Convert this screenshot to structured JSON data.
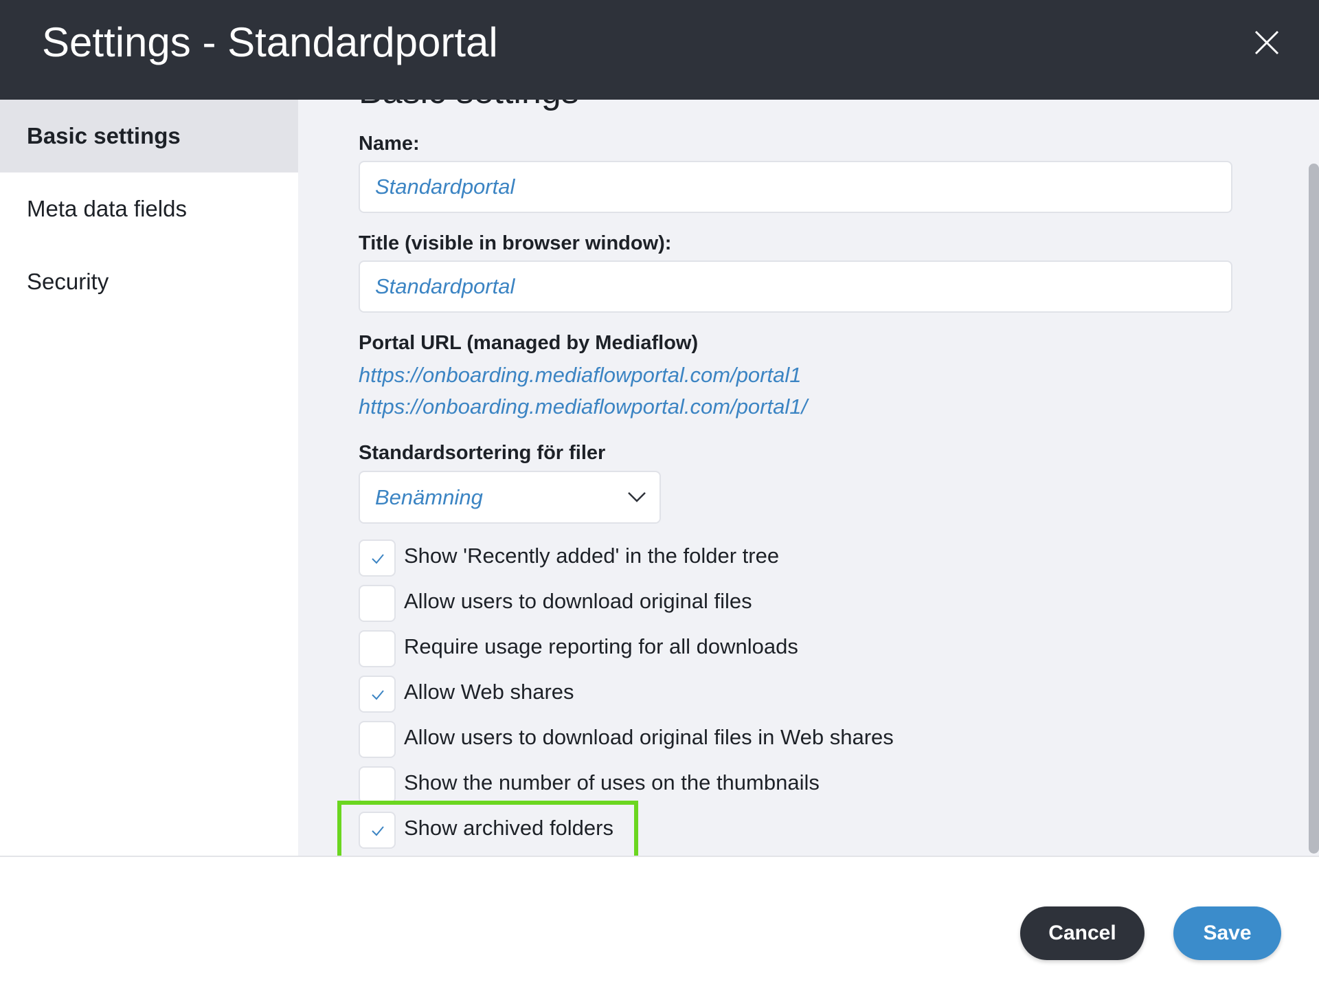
{
  "header": {
    "title": "Settings - Standardportal"
  },
  "sidebar": {
    "items": [
      {
        "label": "Basic settings",
        "active": true
      },
      {
        "label": "Meta data fields",
        "active": false
      },
      {
        "label": "Security",
        "active": false
      }
    ]
  },
  "main": {
    "section_title": "Basic settings",
    "name_label": "Name:",
    "name_value": "Standardportal",
    "title_label": "Title (visible in browser window):",
    "title_value": "Standardportal",
    "portal_url_label": "Portal URL (managed by Mediaflow)",
    "portal_urls": [
      "https://onboarding.mediaflowportal.com/portal1",
      "https://onboarding.mediaflowportal.com/portal1/"
    ],
    "sort_label": "Standardsortering för filer",
    "sort_value": "Benämning",
    "checkboxes": [
      {
        "label": "Show 'Recently added' in the folder tree",
        "checked": true
      },
      {
        "label": "Allow users to download original files",
        "checked": false
      },
      {
        "label": "Require usage reporting for all downloads",
        "checked": false
      },
      {
        "label": "Allow Web shares",
        "checked": true
      },
      {
        "label": "Allow users to download original files in Web shares",
        "checked": false
      },
      {
        "label": "Show the number of uses on the thumbnails",
        "checked": false
      },
      {
        "label": "Show archived folders",
        "checked": true
      }
    ]
  },
  "footer": {
    "cancel_label": "Cancel",
    "save_label": "Save"
  },
  "icons": {
    "close": "close-icon",
    "chevron": "chevron-down-icon",
    "check": "checkmark-icon"
  },
  "colors": {
    "header_bg": "#2e323a",
    "accent_blue": "#3b84c3",
    "save_button": "#3b8ccb",
    "highlight_box": "#6bd620"
  }
}
